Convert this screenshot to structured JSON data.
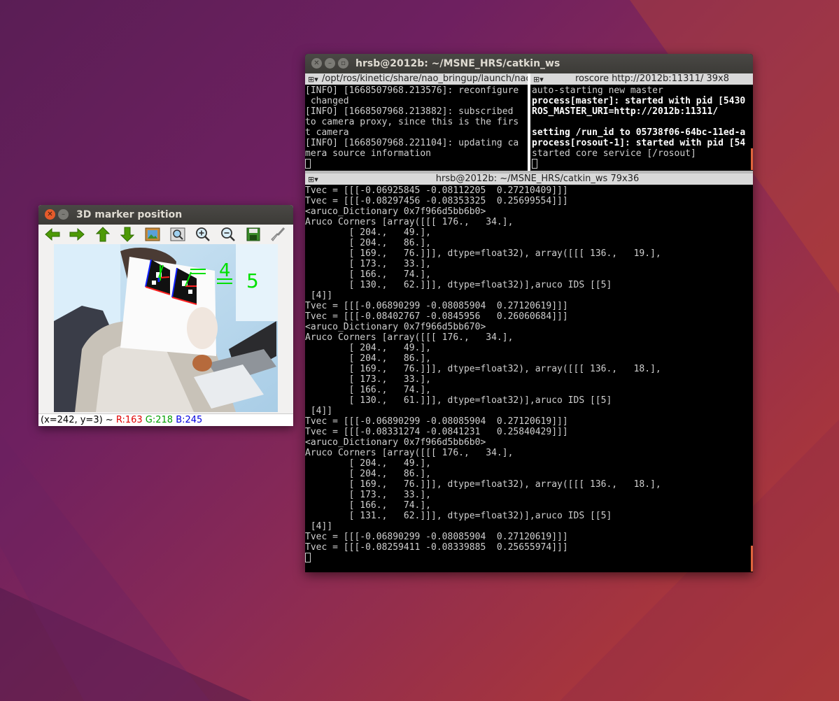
{
  "viewer": {
    "title": "3D marker position",
    "toolbar": [
      {
        "name": "pan-left-button",
        "icon": "arrow-left-icon"
      },
      {
        "name": "pan-right-button",
        "icon": "arrow-right-icon"
      },
      {
        "name": "pan-up-button",
        "icon": "arrow-up-icon"
      },
      {
        "name": "pan-down-button",
        "icon": "arrow-down-icon"
      },
      {
        "name": "zoom-original-button",
        "icon": "image-icon"
      },
      {
        "name": "zoom-fit-button",
        "icon": "zoom-fit-icon"
      },
      {
        "name": "zoom-in-button",
        "icon": "zoom-in-icon"
      },
      {
        "name": "zoom-out-button",
        "icon": "zoom-out-icon"
      },
      {
        "name": "save-button",
        "icon": "save-icon"
      },
      {
        "name": "properties-button",
        "icon": "brush-icon"
      }
    ],
    "overlay_labels": [
      "4",
      "5"
    ],
    "status": {
      "coords": "(x=242, y=3) ~ ",
      "r": "R:163",
      "g": "G:218",
      "b": "B:245"
    }
  },
  "terminal": {
    "title": "hrsb@2012b: ~/MSNE_HRS/catkin_ws",
    "top_left_tab": "/opt/ros/kinetic/share/nao_bringup/launch/nao",
    "top_right_tab": "roscore http://2012b:11311/ 39x8",
    "bottom_tab": "hrsb@2012b: ~/MSNE_HRS/catkin_ws 79x36",
    "top_left_lines": [
      "[INFO] [1668507968.213576]: reconfigure",
      " changed",
      "[INFO] [1668507968.213882]: subscribed",
      "to camera proxy, since this is the firs",
      "t camera",
      "[INFO] [1668507968.221104]: updating ca",
      "mera source information"
    ],
    "top_right_lines": [
      {
        "text": "auto-starting new master",
        "bold": false
      },
      {
        "text": "process[master]: started with pid [5430",
        "bold": true
      },
      {
        "text": "ROS_MASTER_URI=http://2012b:11311/",
        "bold": true
      },
      {
        "text": "",
        "bold": false
      },
      {
        "text": "setting /run_id to 05738f06-64bc-11ed-a",
        "bold": true
      },
      {
        "text": "process[rosout-1]: started with pid [54",
        "bold": true
      },
      {
        "text": "started core service [/rosout]",
        "bold": false
      }
    ],
    "bottom_lines": [
      "Tvec = [[[-0.06925845 -0.08112205  0.27210409]]]",
      "Tvec = [[[-0.08297456 -0.08353325  0.25699554]]]",
      "<aruco_Dictionary 0x7f966d5bb6b0>",
      "Aruco Corners [array([[[ 176.,   34.],",
      "        [ 204.,   49.],",
      "        [ 204.,   86.],",
      "        [ 169.,   76.]]], dtype=float32), array([[[ 136.,   19.],",
      "        [ 173.,   33.],",
      "        [ 166.,   74.],",
      "        [ 130.,   62.]]], dtype=float32)],aruco IDS [[5]",
      " [4]]",
      "Tvec = [[[-0.06890299 -0.08085904  0.27120619]]]",
      "Tvec = [[[-0.08402767 -0.0845956   0.26060684]]]",
      "<aruco_Dictionary 0x7f966d5bb670>",
      "Aruco Corners [array([[[ 176.,   34.],",
      "        [ 204.,   49.],",
      "        [ 204.,   86.],",
      "        [ 169.,   76.]]], dtype=float32), array([[[ 136.,   18.],",
      "        [ 173.,   33.],",
      "        [ 166.,   74.],",
      "        [ 130.,   61.]]], dtype=float32)],aruco IDS [[5]",
      " [4]]",
      "Tvec = [[[-0.06890299 -0.08085904  0.27120619]]]",
      "Tvec = [[[-0.08331274 -0.0841231   0.25840429]]]",
      "<aruco_Dictionary 0x7f966d5bb6b0>",
      "Aruco Corners [array([[[ 176.,   34.],",
      "        [ 204.,   49.],",
      "        [ 204.,   86.],",
      "        [ 169.,   76.]]], dtype=float32), array([[[ 136.,   18.],",
      "        [ 173.,   33.],",
      "        [ 166.,   74.],",
      "        [ 131.,   62.]]], dtype=float32)],aruco IDS [[5]",
      " [4]]",
      "Tvec = [[[-0.06890299 -0.08085904  0.27120619]]]",
      "Tvec = [[[-0.08259411 -0.08339885  0.25655974]]]"
    ]
  },
  "colors": {
    "ubuntu_orange": "#e55b2b",
    "status_r": "#e00000",
    "status_g": "#00a000",
    "status_b": "#0000e0",
    "marker_green": "#00e000"
  }
}
